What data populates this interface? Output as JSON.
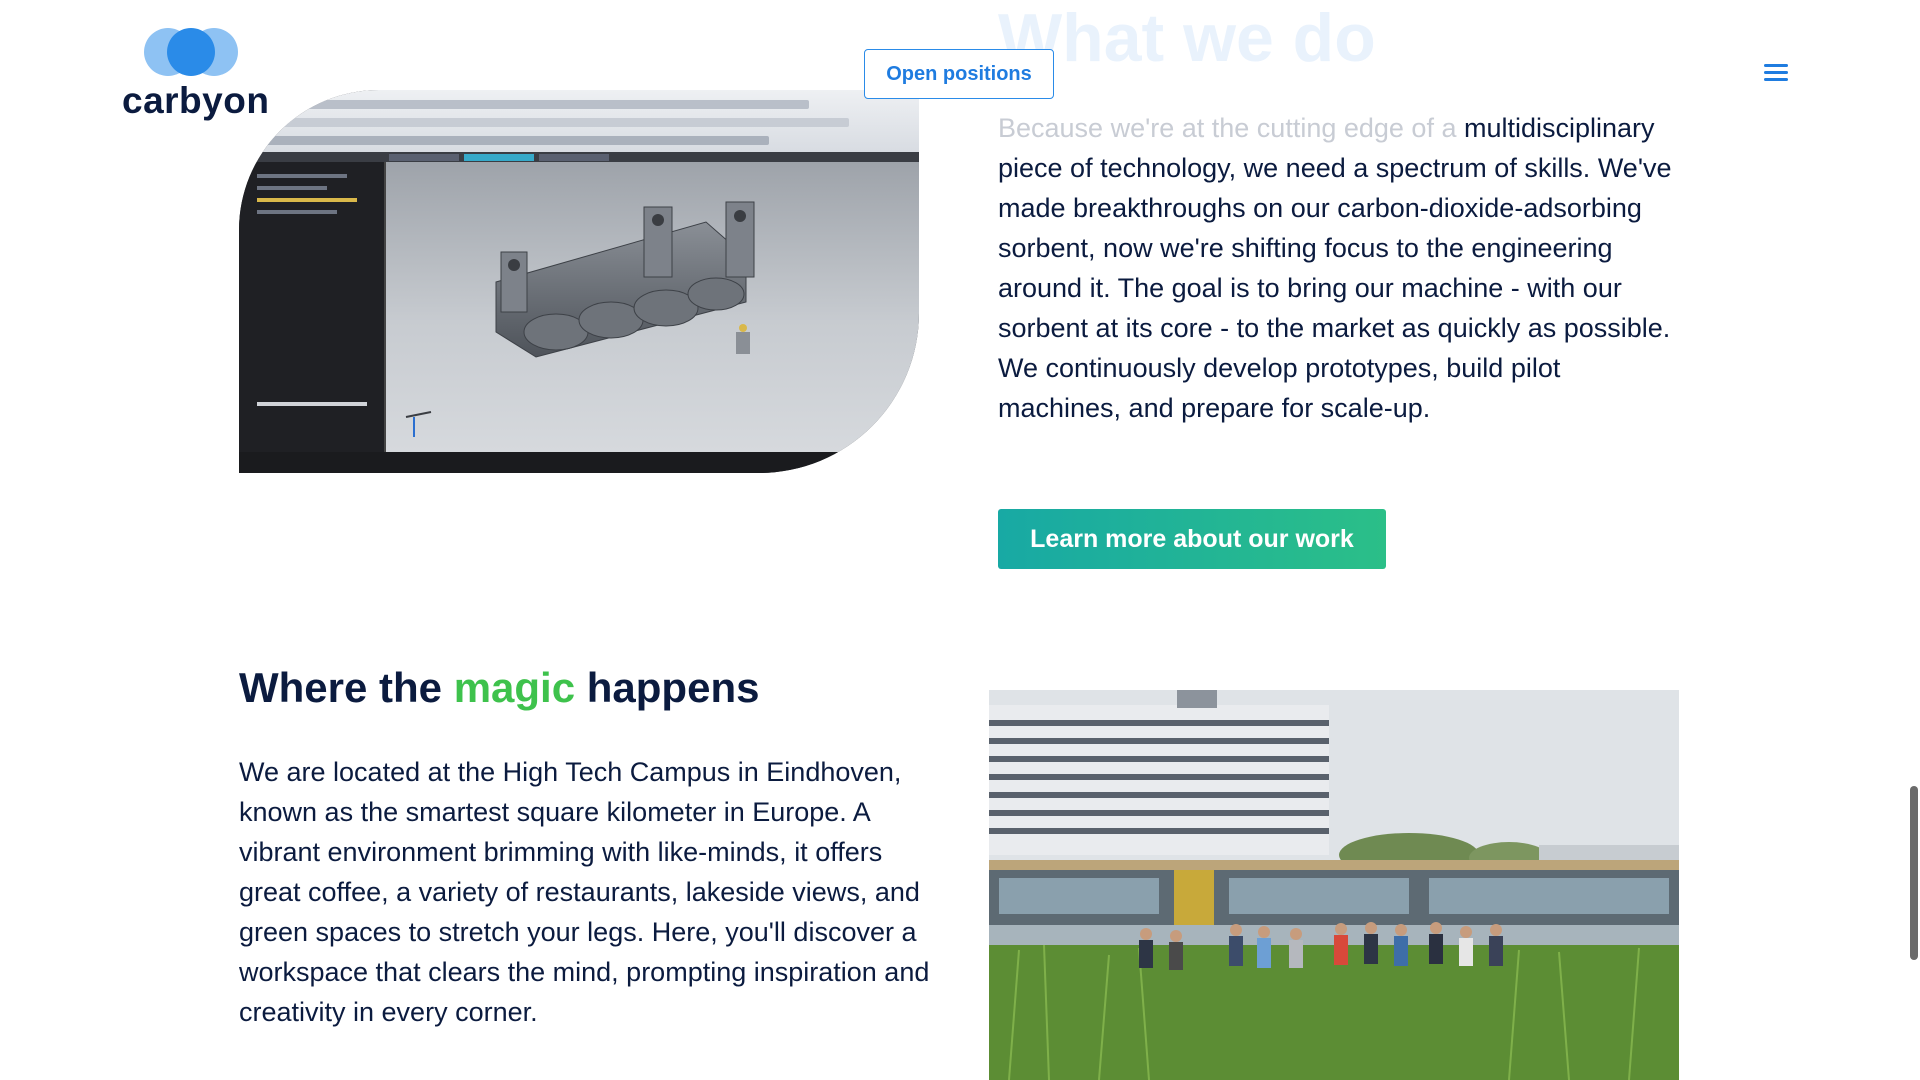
{
  "header": {
    "logo_text": "carbyon",
    "open_positions_label": "Open positions",
    "menu_icon": "hamburger-menu-icon"
  },
  "what_we_do": {
    "title": "What we do",
    "paragraph_faded": "Because we're at the cutting edge of a",
    "paragraph": "multidisciplinary piece of technology, we need a spectrum of skills. We've made breakthroughs on our carbon-dioxide-adsorbing sorbent, now we're shifting focus to the engineering around it. The goal is to bring our machine - with our sorbent at its core - to the market as quickly as possible. We continuously develop prototypes, build pilot machines, and prepare for scale-up.",
    "button_label": "Learn more about our work"
  },
  "magic": {
    "title_before": "Where the ",
    "title_accent": "magic",
    "title_after": " happens",
    "paragraph": "We are located at the High Tech Campus in Eindhoven, known as the smartest square kilometer in Europe. A vibrant environment brimming with like-minds, it offers great coffee, a variety of restaurants, lakeside views, and green spaces to stretch your legs. Here, you'll discover a workspace that clears the mind, prompting inspiration and creativity in every corner."
  },
  "colors": {
    "navy": "#0b1b3f",
    "brand_blue": "#1f7ce0",
    "accent_green": "#3ec24c",
    "button_gradient_start": "#18a9a4",
    "button_gradient_end": "#2bbf88"
  }
}
